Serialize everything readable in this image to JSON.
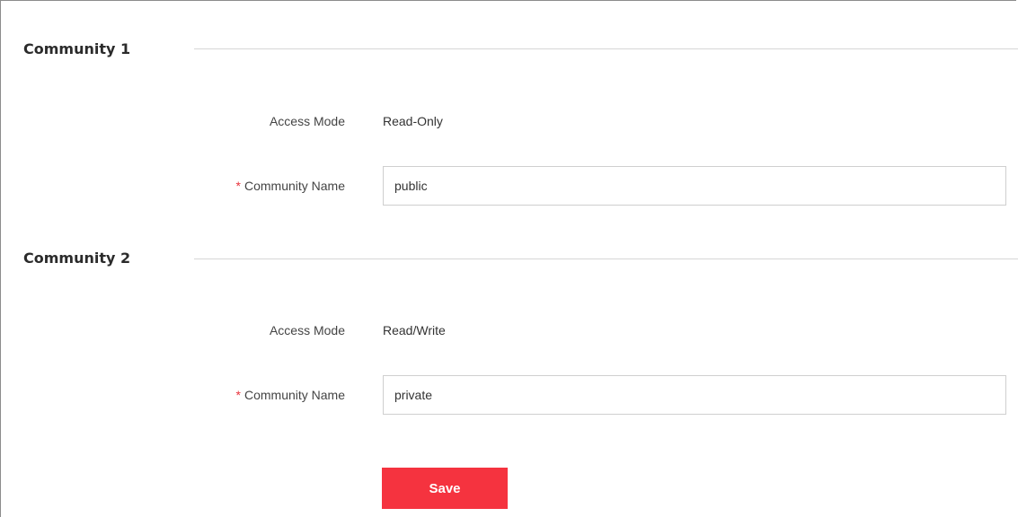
{
  "community1": {
    "title": "Community 1",
    "access_mode_label": "Access Mode",
    "access_mode_value": "Read-Only",
    "required_mark": "*",
    "name_label": "Community Name",
    "name_value": "public"
  },
  "community2": {
    "title": "Community 2",
    "access_mode_label": "Access Mode",
    "access_mode_value": "Read/Write",
    "required_mark": "*",
    "name_label": "Community Name",
    "name_value": "private"
  },
  "actions": {
    "save_label": "Save"
  },
  "colors": {
    "accent": "#f5333f",
    "required": "#e8333c",
    "divider": "#d6d6d6"
  }
}
